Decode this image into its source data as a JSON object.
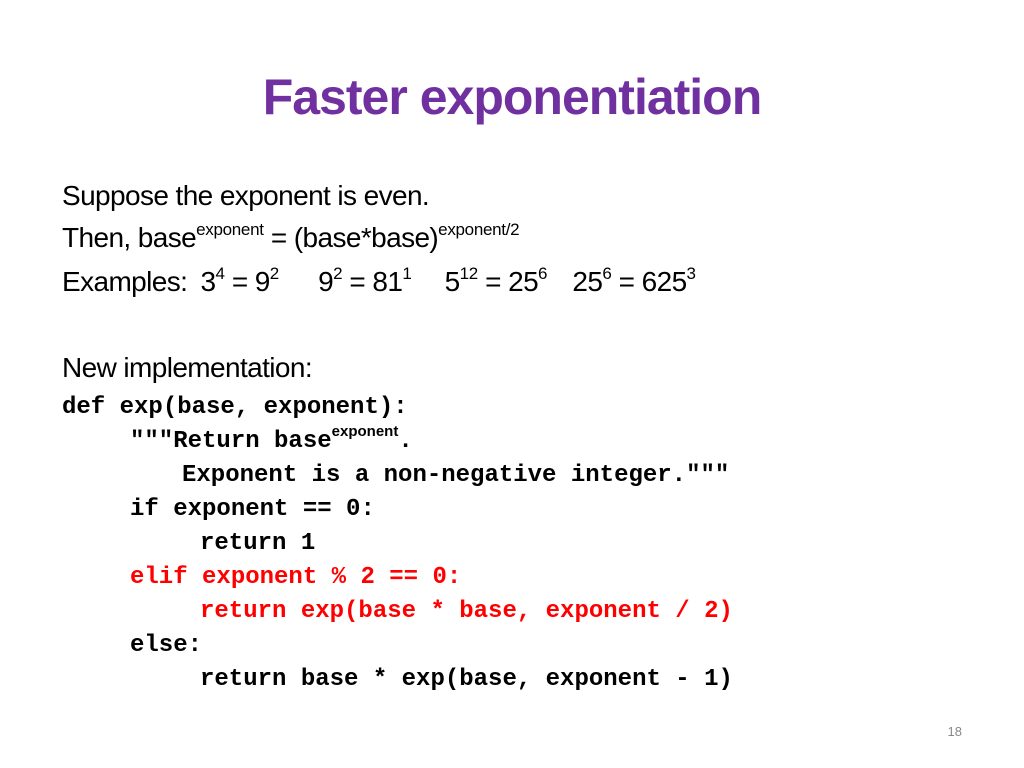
{
  "colors": {
    "title": "#7030a0",
    "highlight": "#ff0000",
    "text": "#000000",
    "page_number": "#888888"
  },
  "slide": {
    "title": "Faster exponentiation",
    "lines": {
      "intro": "Suppose the exponent is even.",
      "then": {
        "prefix": "Then,  base",
        "sup1": "exponent",
        "middle": " = (base*base)",
        "sup2": "exponent/2"
      },
      "examples": {
        "label": "Examples:",
        "items": [
          {
            "lhs_base": "3",
            "lhs_exp": "4",
            "rhs_base": "9",
            "rhs_exp": "2"
          },
          {
            "lhs_base": "9",
            "lhs_exp": "2",
            "rhs_base": "81",
            "rhs_exp": "1"
          },
          {
            "lhs_base": "5",
            "lhs_exp": "12",
            "rhs_base": "25",
            "rhs_exp": "6"
          },
          {
            "lhs_base": "25",
            "lhs_exp": "6",
            "rhs_base": "625",
            "rhs_exp": "3"
          }
        ],
        "equals": " = "
      },
      "new_impl": "New implementation:"
    },
    "code": {
      "line1": "def exp(base, exponent):",
      "line2_prefix": "\"\"\"Return base",
      "line2_sup": "exponent",
      "line2_suffix": ".",
      "line3": "Exponent is a non-negative integer.\"\"\"",
      "line4": "if exponent == 0:",
      "line5": "return 1",
      "line6": "elif exponent % 2 == 0:",
      "line7": "return exp(base * base, exponent / 2)",
      "line8": "else:",
      "line9": "return base * exp(base, exponent - 1)"
    },
    "page_number": "18"
  }
}
